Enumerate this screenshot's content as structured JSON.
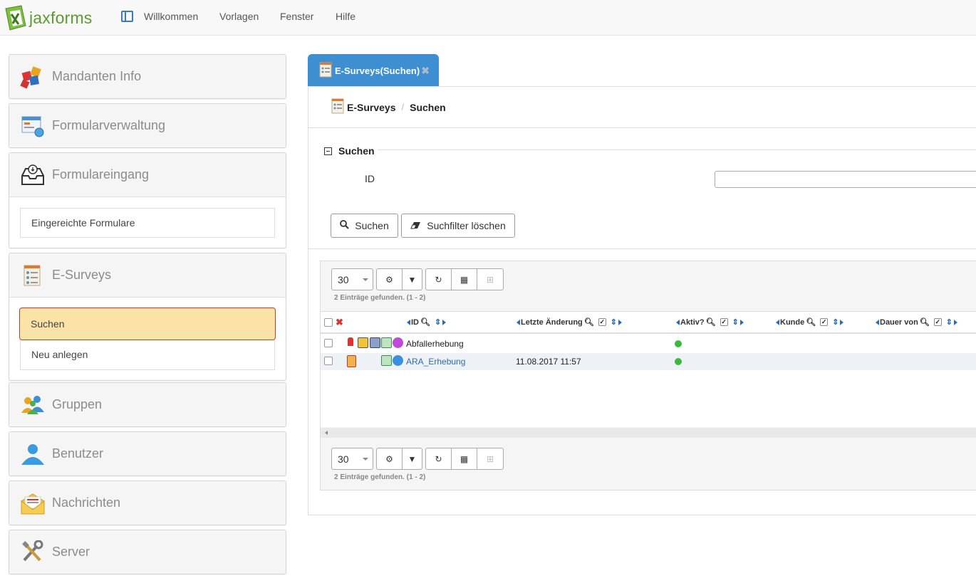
{
  "app": {
    "brand": "jaxforms"
  },
  "topnav": {
    "items": [
      "Willkommen",
      "Vorlagen",
      "Fenster",
      "Hilfe"
    ]
  },
  "sidebar": {
    "mandanten": "Mandanten Info",
    "formularverwaltung": "Formularverwaltung",
    "formulareingang": "Formulareingang",
    "eingereichte": "Eingereichte Formulare",
    "esurveys": "E-Surveys",
    "suchen": "Suchen",
    "neu": "Neu anlegen",
    "gruppen": "Gruppen",
    "benutzer": "Benutzer",
    "nachrichten": "Nachrichten",
    "server": "Server"
  },
  "tab": {
    "label": "E-Surveys(Suchen)",
    "close": "✖"
  },
  "breadcrumb": {
    "first": "E-Surveys",
    "separator": "/",
    "second": "Suchen"
  },
  "search": {
    "legend": "Suchen",
    "id_label": "ID",
    "id_value": "",
    "search_button": "Suchen",
    "clear_button": "Suchfilter löschen"
  },
  "grid": {
    "page_size": "30",
    "count_text": "2 Einträge gefunden. (1 - 2)",
    "columns": [
      "ID",
      "Letzte Änderung",
      "Aktiv?",
      "Kunde",
      "Dauer von"
    ],
    "rows": [
      {
        "id": "Abfallerhebung",
        "changed": ""
      },
      {
        "id": "ARA_Erhebung",
        "changed": "11.08.2017 11:57"
      }
    ]
  },
  "colors": {
    "accent": "#3d8fd1",
    "brand_green": "#5a9c2c",
    "active_bg": "#fbe3a7",
    "active_border": "#c23b2e",
    "status_green": "#3cb93c"
  }
}
